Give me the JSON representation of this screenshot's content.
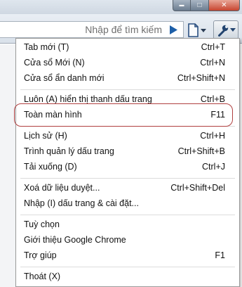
{
  "window": {
    "buttons": [
      {
        "name": "minimize",
        "glyph": "▬"
      },
      {
        "name": "maximize",
        "glyph": "□"
      },
      {
        "name": "close",
        "glyph": "✕"
      }
    ]
  },
  "toolbar": {
    "search_placeholder": "Nhập để tìm kiếm",
    "icons": [
      "go-arrow-icon",
      "page-menu-icon",
      "wrench-icon"
    ]
  },
  "menu": {
    "items": [
      {
        "label": "Tab mới (T)",
        "shortcut": "Ctrl+T"
      },
      {
        "label": "Cửa sổ Mới (N)",
        "shortcut": "Ctrl+N"
      },
      {
        "label": "Cửa sổ ẩn danh mới",
        "shortcut": "Ctrl+Shift+N"
      },
      {
        "label": "Luôn (A) hiển thị thanh dấu trang",
        "shortcut": "Ctrl+B"
      },
      {
        "label": "Toàn màn hình",
        "shortcut": "F11"
      },
      {
        "label": "Lịch sử (H)",
        "shortcut": "Ctrl+H"
      },
      {
        "label": "Trình quản lý dấu trang",
        "shortcut": "Ctrl+Shift+B"
      },
      {
        "label": "Tải xuống (D)",
        "shortcut": "Ctrl+J"
      },
      {
        "label": "Xoá dữ liệu duyệt...",
        "shortcut": "Ctrl+Shift+Del"
      },
      {
        "label": "Nhập (I) dấu trang & cài đặt...",
        "shortcut": ""
      },
      {
        "label": "Tuỳ chọn",
        "shortcut": ""
      },
      {
        "label": "Giới thiệu Google Chrome",
        "shortcut": ""
      },
      {
        "label": "Trợ giúp",
        "shortcut": "F1"
      },
      {
        "label": "Thoát (X)",
        "shortcut": ""
      }
    ]
  },
  "colors": {
    "highlight_ring": "#b04040",
    "menu_border": "#9a9a9a"
  }
}
